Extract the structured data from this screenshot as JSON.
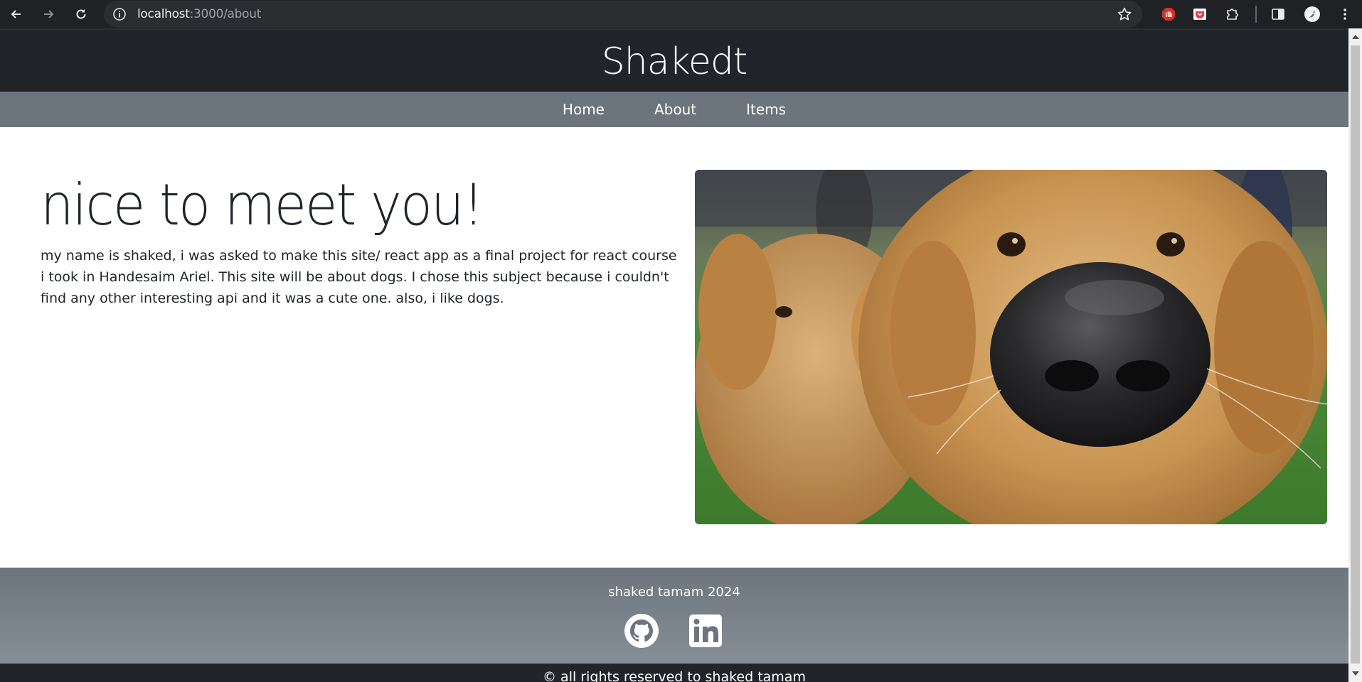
{
  "browser": {
    "url_host": "localhost",
    "url_path": ":3000/about"
  },
  "header": {
    "title": "Shakedt"
  },
  "nav": {
    "items": [
      "Home",
      "About",
      "Items"
    ]
  },
  "main": {
    "heading": "nice to meet you!",
    "paragraph": "my name is shaked, i was asked to make this site/ react app as a final project for react course i took in Handesaim Ariel. This site will be about dogs. I chose this subject because i couldn't find any other interesting api and it was a cute one. also, i like dogs."
  },
  "footer": {
    "name": "shaked tamam 2024",
    "social_icons": [
      "github-icon",
      "linkedin-icon"
    ],
    "copyright": "© all rights reserved to shaked tamam"
  },
  "colors": {
    "header_bg": "#212529",
    "nav_bg": "#6c757d",
    "footer_bg": "#6c757d"
  }
}
